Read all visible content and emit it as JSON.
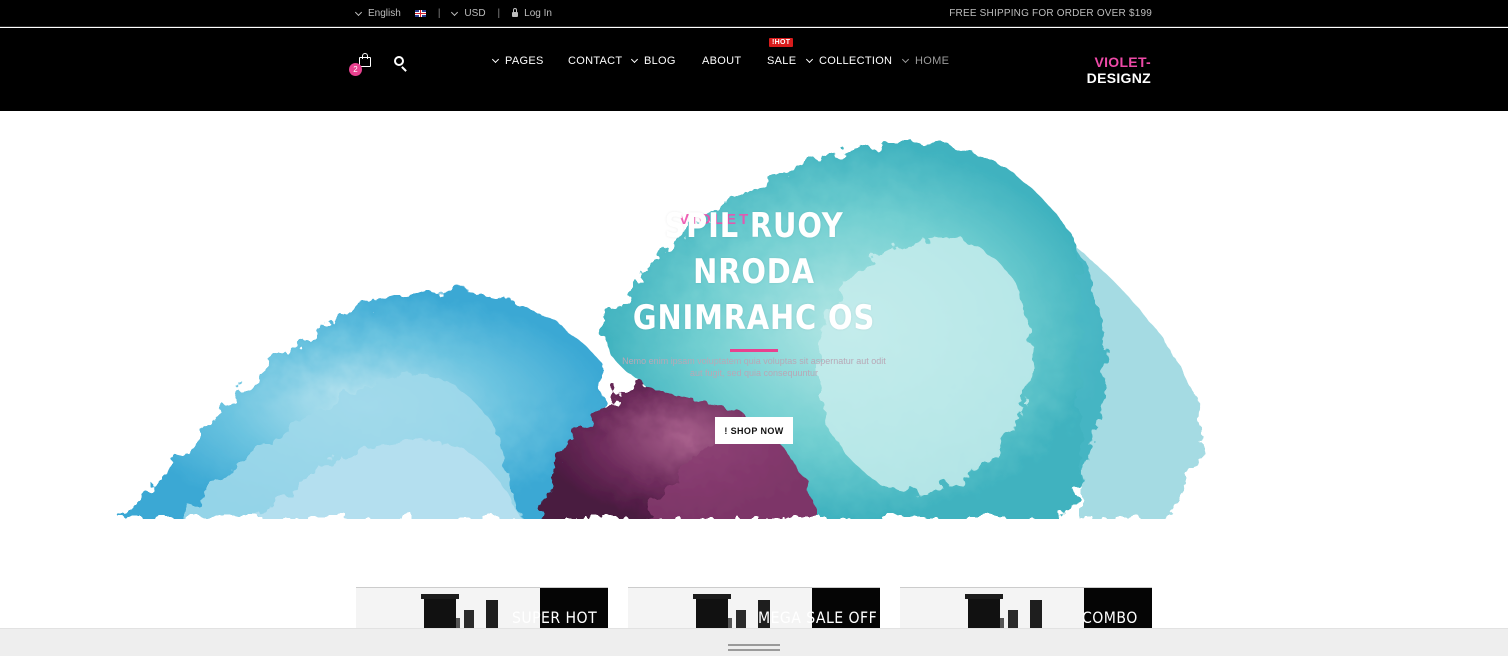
{
  "topbar": {
    "language": "English",
    "currency": "USD",
    "separator": "|",
    "login": "Log In",
    "free_shipping": "FREE SHIPPING FOR ORDER OVER $199",
    "flag_icon": "uk-flag-icon"
  },
  "header": {
    "cart_count": "2",
    "cart_icon": "shopping-bag-icon",
    "search_icon": "search-icon",
    "nav": [
      {
        "label": "PAGES",
        "has_dropdown": true
      },
      {
        "label": "CONTACT",
        "has_dropdown": false
      },
      {
        "label": "BLOG",
        "has_dropdown": true
      },
      {
        "label": "ABOUT",
        "has_dropdown": false
      },
      {
        "label": "SALE",
        "has_dropdown": false
      },
      {
        "label": "COLLECTION",
        "has_dropdown": true
      },
      {
        "label": "HOME",
        "has_dropdown": true,
        "active": true
      }
    ],
    "hot_badge": "!HOT",
    "logo_line1": "VIOLET-",
    "logo_line2": "DESIGNZ"
  },
  "hero": {
    "subtitle": "VIOLET",
    "title_line1": "SPIL RUOY NRODA",
    "title_line2": "GNIMRAHC OS",
    "description": "Nemo enim ipsam voluptatem quia voluptas sit aspernatur aut odit aut fugit, sed quia consequuntur",
    "cta": "! SHOP NOW"
  },
  "promos": [
    {
      "label": "SUPER HOT"
    },
    {
      "label": "MEGA SALE OFF"
    },
    {
      "label": "COMBO"
    }
  ],
  "colors": {
    "accent": "#e8418f",
    "header_bg": "#000000",
    "hot_badge": "#d81c1c"
  }
}
